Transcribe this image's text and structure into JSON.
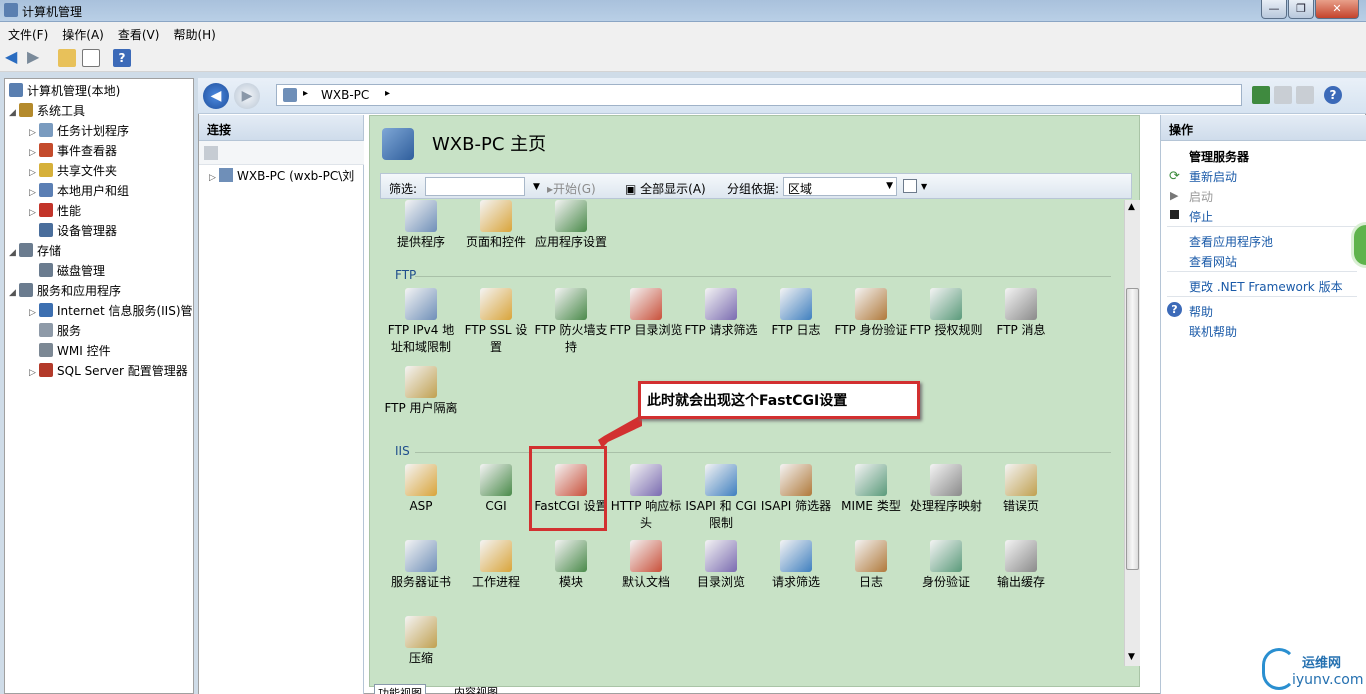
{
  "window": {
    "title": "计算机管理",
    "min": "—",
    "max": "❐",
    "close": "✕"
  },
  "menu": [
    "文件(F)",
    "操作(A)",
    "查看(V)",
    "帮助(H)"
  ],
  "tree": {
    "root": "计算机管理(本地)",
    "items": [
      {
        "label": "系统工具",
        "level": 1,
        "color": "#b48a2c"
      },
      {
        "label": "任务计划程序",
        "level": 2,
        "color": "#7a9bbf"
      },
      {
        "label": "事件查看器",
        "level": 2,
        "color": "#c44b2c"
      },
      {
        "label": "共享文件夹",
        "level": 2,
        "color": "#d6b03a"
      },
      {
        "label": "本地用户和组",
        "level": 2,
        "color": "#5b7fb4"
      },
      {
        "label": "性能",
        "level": 2,
        "color": "#c2342a"
      },
      {
        "label": "设备管理器",
        "level": 2,
        "color": "#4a6e9c"
      },
      {
        "label": "存储",
        "level": 1,
        "color": "#6b7c8f"
      },
      {
        "label": "磁盘管理",
        "level": 2,
        "color": "#6b7c8f"
      },
      {
        "label": "服务和应用程序",
        "level": 1,
        "color": "#6b7c8f"
      },
      {
        "label": "Internet 信息服务(IIS)管",
        "level": 2,
        "color": "#3d6fb0"
      },
      {
        "label": "服务",
        "level": 2,
        "color": "#8e9aa8"
      },
      {
        "label": "WMI 控件",
        "level": 2,
        "color": "#7c8894"
      },
      {
        "label": "SQL Server 配置管理器",
        "level": 2,
        "color": "#b33a2a"
      }
    ]
  },
  "address": {
    "path": "WXB-PC",
    "sep": "▸"
  },
  "connections": {
    "title": "连接",
    "node": "WXB-PC (wxb-PC\\刘"
  },
  "main": {
    "title": "WXB-PC 主页",
    "filter": {
      "label": "筛选:",
      "start": "开始(G)",
      "showall": "全部显示(A)",
      "groupby_label": "分组依据:",
      "groupby_value": "区域"
    },
    "top_items": [
      "提供程序",
      "页面和控件",
      "应用程序设置"
    ],
    "groups": [
      {
        "name": "FTP",
        "items": [
          "FTP IPv4 地址和域限制",
          "FTP SSL 设置",
          "FTP 防火墙支持",
          "FTP 目录浏览",
          "FTP 请求筛选",
          "FTP 日志",
          "FTP 身份验证",
          "FTP 授权规则",
          "FTP 消息",
          "FTP 用户隔离"
        ]
      },
      {
        "name": "IIS",
        "items": [
          "ASP",
          "CGI",
          "FastCGI 设置",
          "HTTP 响应标头",
          "ISAPI 和 CGI 限制",
          "ISAPI 筛选器",
          "MIME 类型",
          "处理程序映射",
          "错误页",
          "服务器证书",
          "工作进程",
          "模块",
          "默认文档",
          "目录浏览",
          "请求筛选",
          "日志",
          "身份验证",
          "输出缓存",
          "压缩"
        ]
      }
    ],
    "tabs": [
      "功能视图",
      "内容视图"
    ]
  },
  "actions": {
    "title": "操作",
    "section": "管理服务器",
    "items": [
      {
        "label": "重新启动",
        "enabled": true
      },
      {
        "label": "启动",
        "enabled": false
      },
      {
        "label": "停止",
        "enabled": true
      },
      {
        "label": "查看应用程序池",
        "enabled": true
      },
      {
        "label": "查看网站",
        "enabled": true
      },
      {
        "label": "更改 .NET Framework 版本",
        "enabled": true
      },
      {
        "label": "帮助",
        "enabled": true
      },
      {
        "label": "联机帮助",
        "enabled": true
      }
    ]
  },
  "annotation": {
    "text": "此时就会出现这个FastCGI设置"
  },
  "watermark": {
    "brand": "运维网",
    "site": "iyunv.com"
  }
}
